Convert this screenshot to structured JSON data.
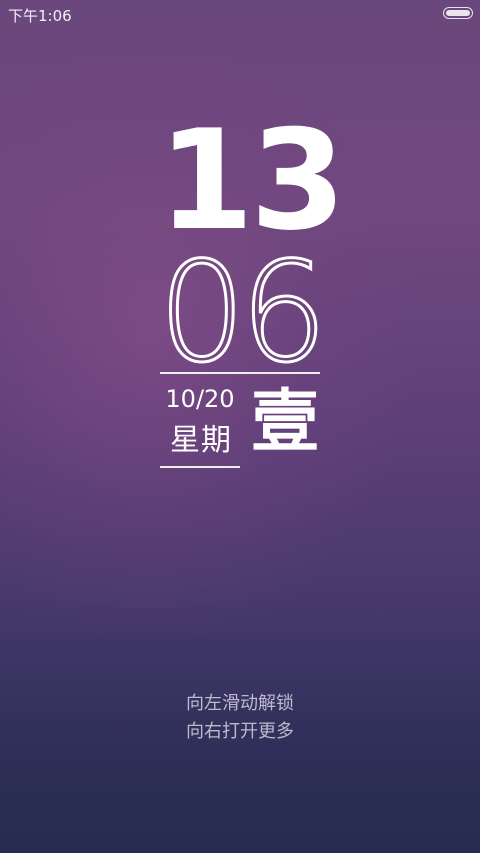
{
  "status_bar": {
    "time": "下午1:06",
    "battery_icon": "battery-icon"
  },
  "clock": {
    "hours": "13",
    "minutes": "06"
  },
  "date": {
    "month_day": "10/20",
    "weekday_label": "星期",
    "weekday_numeral": "壹"
  },
  "hints": {
    "swipe_left": "向左滑动解锁",
    "swipe_right": "向右打开更多"
  },
  "colors": {
    "background_top": "#6a477c",
    "background_bottom": "#262c50",
    "text": "#ffffff"
  }
}
